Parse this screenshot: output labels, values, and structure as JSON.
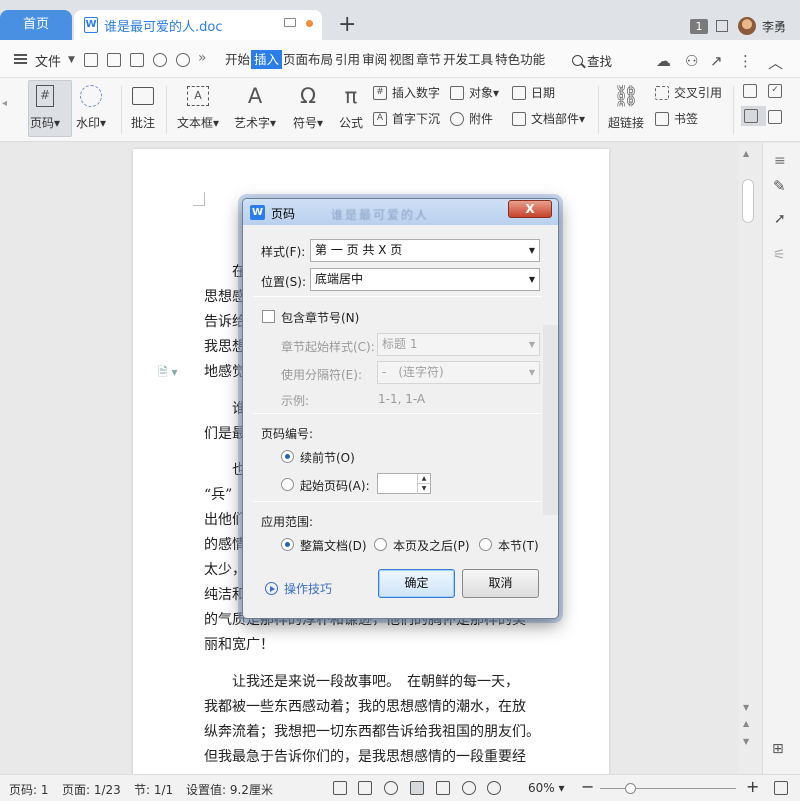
{
  "titlebar": {
    "home_tab": "首页",
    "doc_tab": "谁是最可爱的人.doc",
    "window_count": "1",
    "user_name": "李勇"
  },
  "menu": {
    "file": "文件",
    "tabs": [
      "开始",
      "插入",
      "页面布局",
      "引用",
      "审阅",
      "视图",
      "章节",
      "开发工具",
      "特色功能"
    ],
    "active_tab": "插入",
    "search": "查找"
  },
  "ribbon": {
    "page_number": "页码",
    "watermark": "水印",
    "comment": "批注",
    "textbox": "文本框",
    "wordart": "艺术字",
    "symbol": "符号",
    "formula": "公式",
    "insert_number": "插入数字",
    "drop_cap": "首字下沉",
    "object": "对象",
    "attachment": "附件",
    "date": "日期",
    "doc_parts": "文档部件",
    "hyperlink": "超链接",
    "cross_ref": "交叉引用",
    "bookmark": "书签"
  },
  "document": {
    "lines": [
      "在",
      "思想感",
      "告诉给",
      "我思想",
      "地感觉",
      "谁",
      "们是最",
      "也",
      "“兵”",
      "出他们",
      "的感情",
      "太少，",
      "纯洁和",
      "的气质是那样的淳朴和谦逊，他们的胸怀是那样的美",
      "丽和宽广！",
      "让我还是来说一段故事吧。　在朝鲜的每一天，",
      "我都被一些东西感动着；我的思想感情的潮水，在放",
      "纵奔流着；我想把一切东西都告诉给我祖国的朋友们。",
      "但我最急于告诉你们的，是我思想感情的一段重要经"
    ]
  },
  "dialog": {
    "title": "页码",
    "ghost_title": "谁是最可爱的人",
    "close": "X",
    "style_label": "样式(F):",
    "style_value": "第 一 页 共 X 页",
    "position_label": "位置(S):",
    "position_value": "底端居中",
    "include_chapter": "包含章节号(N)",
    "chapter_style_label": "章节起始样式(C):",
    "chapter_style_value": "标题 1",
    "separator_label": "使用分隔符(E):",
    "separator_value": "-　(连字符)",
    "example_label": "示例:",
    "example_value": "1-1, 1-A",
    "numbering_title": "页码编号:",
    "continue_prev": "续前节(O)",
    "start_at": "起始页码(A):",
    "start_at_value": "",
    "scope_title": "应用范围:",
    "scope_whole": "整篇文档(D)",
    "scope_after": "本页及之后(P)",
    "scope_section": "本节(T)",
    "tips": "操作技巧",
    "ok": "确定",
    "cancel": "取消"
  },
  "status": {
    "page_num": "页码: 1",
    "page": "页面: 1/23",
    "section": "节: 1/1",
    "setting": "设置值: 9.2厘米",
    "zoom": "60%",
    "zoom_level": 0.2
  }
}
